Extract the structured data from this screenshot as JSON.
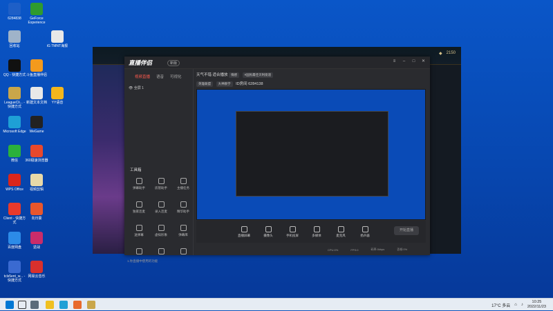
{
  "desktop_icons": [
    {
      "label": "6284838",
      "color": "#1e5fc7"
    },
    {
      "label": "GeForce Experience",
      "color": "#2f9b2f"
    },
    {
      "label": "回收站",
      "color": "#9fb3c9"
    },
    {
      "label": "iG TMNT海报",
      "color": "#e8e8e8"
    },
    {
      "label": "QQ - 快捷方式",
      "color": "#111111"
    },
    {
      "label": "斗鱼直播伴侣",
      "color": "#f39a1d"
    },
    {
      "label": "LeagueCli... - 快捷方式",
      "color": "#c9a64a"
    },
    {
      "label": "新建文本文档",
      "color": "#e8e8e8"
    },
    {
      "label": "YY语音",
      "color": "#f3b61d"
    },
    {
      "label": "Microsoft Edge",
      "color": "#1ea0d6"
    },
    {
      "label": "WeGame",
      "color": "#222222"
    },
    {
      "label": "微信",
      "color": "#2bb13c"
    },
    {
      "label": "360极速浏览器",
      "color": "#e8482c"
    },
    {
      "label": "WPS Office",
      "color": "#d9261c"
    },
    {
      "label": "视频剪辑",
      "color": "#e8d9a8"
    },
    {
      "label": "Client - 快捷方式",
      "color": "#e83a2c"
    },
    {
      "label": "向日葵",
      "color": "#e8562c"
    },
    {
      "label": "百度网盘",
      "color": "#2c8be8"
    },
    {
      "label": "逆战",
      "color": "#c92c6a"
    },
    {
      "label": "tcls5ent_w... - 快捷方式",
      "color": "#3a6ad1"
    },
    {
      "label": "网易云音乐",
      "color": "#d8302c"
    }
  ],
  "app": {
    "logo": "直播伴侣",
    "badge": "新版",
    "tabs": [
      "视频直播",
      "语音",
      "可视化"
    ],
    "scene": "全屏 1",
    "tools_title": "工具箱",
    "tools": [
      "弹幕助手",
      "房管助手",
      "主播任务",
      "独家连麦",
      "录入连麦",
      "精华助手",
      "送弹幕",
      "虚拟形象",
      "弹幕库",
      "",
      "",
      ""
    ],
    "bottom_note": "1.你直播中使用的功能",
    "stream_title": "天气不错 适合播放",
    "stream_tags": [
      "情感",
      "#国民最佳贝利街道"
    ],
    "category": "英雄联盟",
    "category2": "大神教学",
    "room_id_label": "ID房间",
    "room_id": "6284138",
    "controls": [
      "直播屏幕",
      "摄像头",
      "手机投屏",
      "多媒体",
      "麦克风",
      "扬声器"
    ],
    "start_button": "开始直播",
    "status": [
      "CPU:0%",
      "FPS:0",
      "码率:0kbps",
      "丢帧:0%",
      "帧率"
    ]
  },
  "taskbar": {
    "weather": "17°C 多云",
    "time": "10:25",
    "date": "2022/11/23"
  }
}
